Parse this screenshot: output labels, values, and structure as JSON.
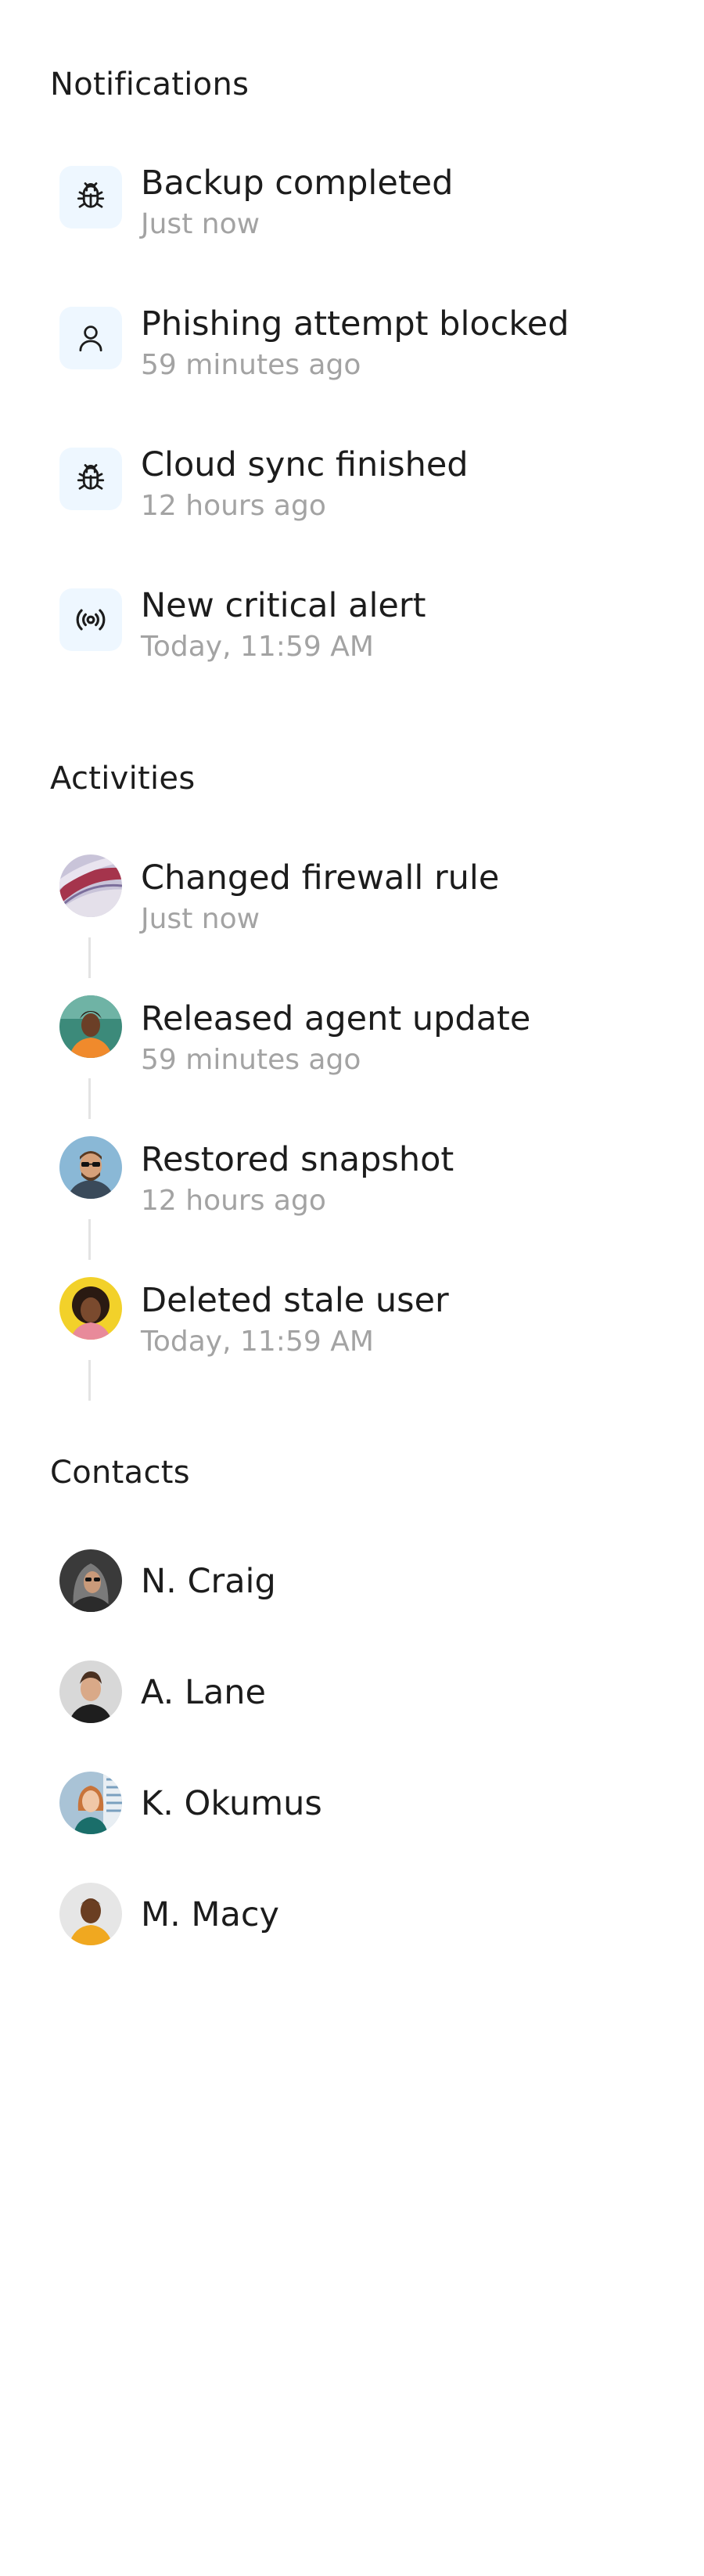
{
  "notifications": {
    "title": "Notifications",
    "items": [
      {
        "icon": "bug-icon",
        "title": "Backup completed",
        "time": "Just now"
      },
      {
        "icon": "user-icon",
        "title": "Phishing attempt blocked",
        "time": "59 minutes ago"
      },
      {
        "icon": "bug-icon",
        "title": "Cloud sync finished",
        "time": "12 hours ago"
      },
      {
        "icon": "broadcast-icon",
        "title": "New critical alert",
        "time": "Today, 11:59 AM"
      }
    ]
  },
  "activities": {
    "title": "Activities",
    "items": [
      {
        "title": "Changed firewall rule",
        "time": "Just now"
      },
      {
        "title": "Released agent update",
        "time": "59 minutes ago"
      },
      {
        "title": "Restored snapshot",
        "time": "12 hours ago"
      },
      {
        "title": "Deleted stale user",
        "time": "Today, 11:59 AM"
      }
    ]
  },
  "contacts": {
    "title": "Contacts",
    "items": [
      {
        "name": "N. Craig"
      },
      {
        "name": "A. Lane"
      },
      {
        "name": "K. Okumus"
      },
      {
        "name": "M. Macy"
      }
    ]
  },
  "colors": {
    "text": "#1c1c1c",
    "muted": "#a3a3a3",
    "icon_bg": "#eef7ff",
    "timeline": "#e3e3e3"
  }
}
